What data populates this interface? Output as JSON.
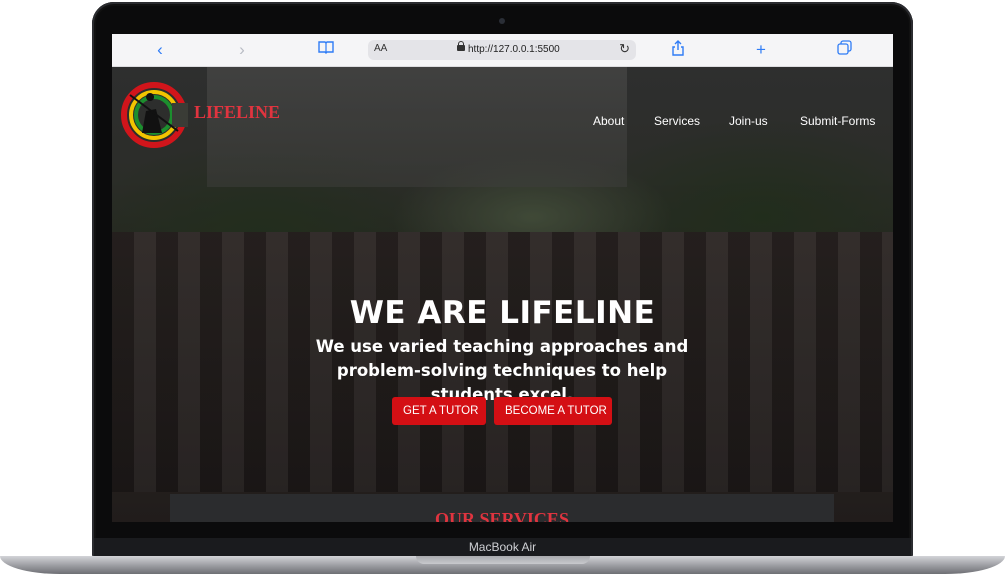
{
  "browser": {
    "back_icon": "chevron-left-icon",
    "forward_icon": "chevron-right-icon",
    "reader_icon": "book-icon",
    "text_size_label": "AA",
    "url": "http://127.0.0.1:5500",
    "reload_icon": "reload-icon",
    "share_icon": "share-icon",
    "new_tab_icon": "plus-icon",
    "tabs_icon": "tabs-icon"
  },
  "site": {
    "brand": "LIFELINE",
    "nav": [
      "About",
      "Services",
      "Join-us",
      "Submit-Forms"
    ],
    "hero": {
      "title": "WE ARE LIFELINE",
      "subtitle": "We use varied teaching approaches and problem-solving techniques to help students excel.",
      "cta_primary": "GET A TUTOR",
      "cta_secondary": "BECOME A TUTOR"
    },
    "services_heading": "OUR SERVICES"
  },
  "device": {
    "label": "MacBook Air"
  },
  "colors": {
    "accent": "#d40f14",
    "brand_red": "#e0343f",
    "link_blue": "#2f7cf6"
  }
}
